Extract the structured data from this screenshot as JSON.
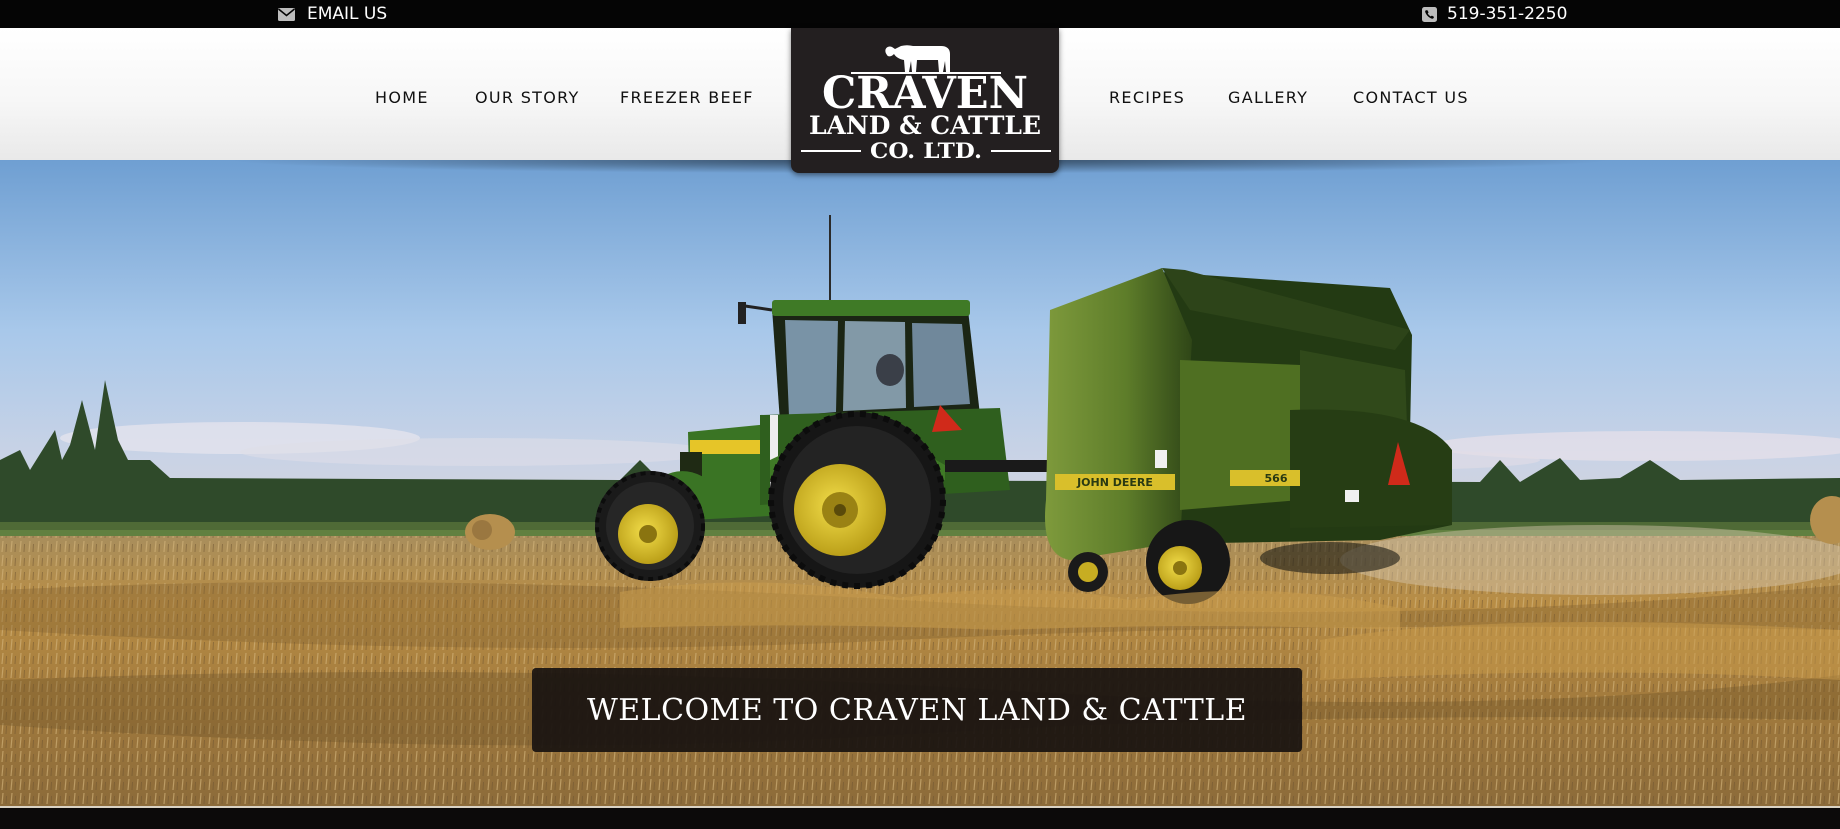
{
  "topbar": {
    "email_label": "EMAIL US",
    "email_icon": "envelope-icon",
    "phone_label": "519-351-2250",
    "phone_icon": "phone-icon"
  },
  "nav": {
    "left": [
      "HOME",
      "OUR STORY",
      "FREEZER BEEF"
    ],
    "right": [
      "RECIPES",
      "GALLERY",
      "CONTACT US"
    ]
  },
  "logo": {
    "line1": "CRAVEN",
    "line2": "LAND & CATTLE",
    "line3": "CO. LTD.",
    "icon": "cow-icon"
  },
  "hero": {
    "welcome_text": "WELCOME TO CRAVEN LAND & CATTLE",
    "baler_brand": "JOHN DEERE",
    "baler_model": "566"
  },
  "colors": {
    "topbar_bg": "#050505",
    "logo_bg": "#231f20",
    "tractor_green": "#3f7a26",
    "wheel_yellow": "#e5cc2a"
  }
}
